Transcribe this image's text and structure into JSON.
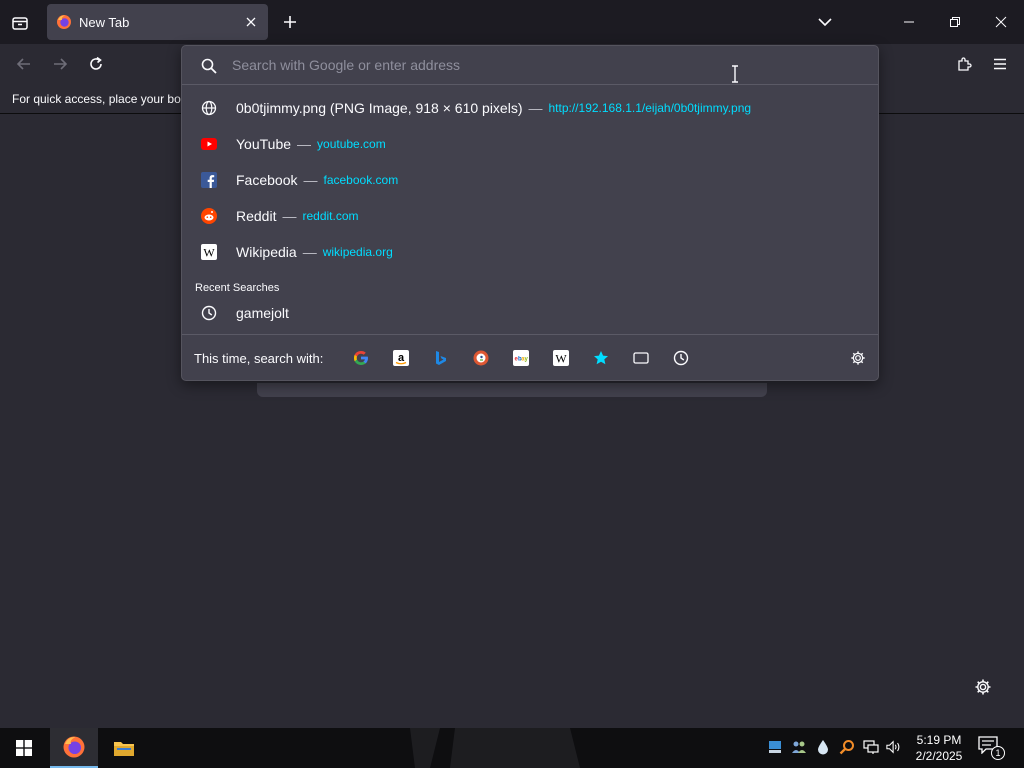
{
  "browser": {
    "tab": {
      "title": "New Tab"
    },
    "bookmarks_bar": {
      "message": "For quick access, place your boc"
    }
  },
  "urlbar": {
    "placeholder": "Search with Google or enter address",
    "value": "",
    "results": [
      {
        "icon": "globe-icon",
        "title": "0b0tjimmy.png (PNG Image, 918 × 610 pixels)",
        "separator": "—",
        "url": "http://192.168.1.1/eijah/0b0tjimmy.png"
      },
      {
        "icon": "youtube-icon",
        "title": "YouTube",
        "separator": "—",
        "url": "youtube.com"
      },
      {
        "icon": "facebook-icon",
        "title": "Facebook",
        "separator": "—",
        "url": "facebook.com"
      },
      {
        "icon": "reddit-icon",
        "title": "Reddit",
        "separator": "—",
        "url": "reddit.com"
      },
      {
        "icon": "wikipedia-icon",
        "title": "Wikipedia",
        "separator": "—",
        "url": "wikipedia.org"
      }
    ],
    "recent_searches_label": "Recent Searches",
    "recent_searches": [
      {
        "icon": "history-icon",
        "title": "gamejolt"
      }
    ],
    "oneoff_label": "This time, search with:",
    "engines": [
      "google-icon",
      "amazon-icon",
      "bing-icon",
      "duckduckgo-icon",
      "ebay-icon",
      "wikipedia-icon",
      "bookmarks-icon",
      "tabs-icon",
      "history-icon"
    ]
  },
  "taskbar": {
    "clock_time": "5:19 PM",
    "clock_date": "2/2/2025",
    "notification_count": "1"
  },
  "colors": {
    "url_link": "#00ddff",
    "popup_bg": "#42414d",
    "content_bg": "#2b2a33",
    "tabstrip_bg": "#1c1b22"
  }
}
